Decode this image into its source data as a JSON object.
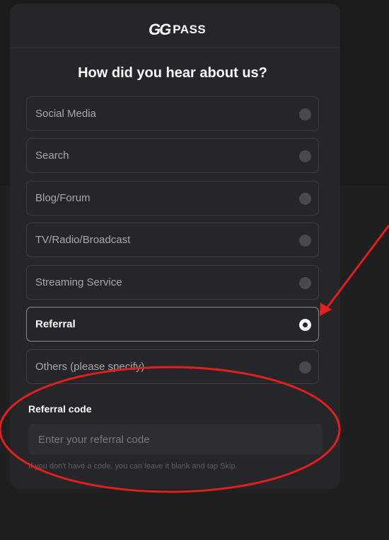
{
  "brand": {
    "logo_gg": "GG",
    "logo_pass": "PASS"
  },
  "title": "How did you hear about us?",
  "options": [
    {
      "label": "Social Media",
      "selected": false
    },
    {
      "label": "Search",
      "selected": false
    },
    {
      "label": "Blog/Forum",
      "selected": false
    },
    {
      "label": "TV/Radio/Broadcast",
      "selected": false
    },
    {
      "label": "Streaming Service",
      "selected": false
    },
    {
      "label": "Referral",
      "selected": true
    },
    {
      "label": "Others (please specify)",
      "selected": false
    }
  ],
  "referral": {
    "label": "Referral code",
    "placeholder": "Enter your referral code",
    "value": "",
    "hint": "If you don't have a code, you can leave it blank and tap Skip."
  },
  "colors": {
    "annotation": "#e0201f",
    "panel": "#262628",
    "background": "#1b1b1c"
  }
}
